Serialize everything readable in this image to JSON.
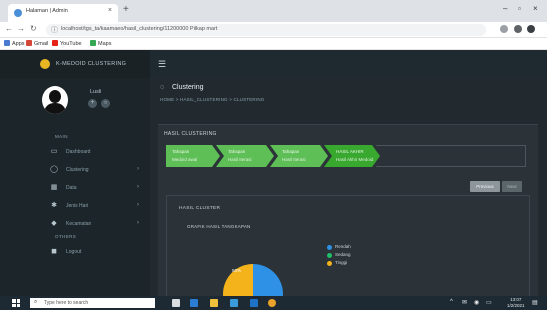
{
  "browser": {
    "tab_title": "Halaman | Admin",
    "tab_close": "×",
    "new_tab": "+",
    "url": "localhost/tgs_ta/kaamaeo/hasil_clustering/11200000 Pilkap mart",
    "window_min": "–",
    "window_max": "▫",
    "window_close": "×",
    "bookmarks": [
      {
        "label": "Apps",
        "color": "#4a7bd0"
      },
      {
        "label": "Gmail",
        "color": "#d44638"
      },
      {
        "label": "YouTube",
        "color": "#e62117"
      },
      {
        "label": "Maps",
        "color": "#34a853"
      }
    ]
  },
  "app": {
    "brand": "K-MEDOID CLUSTERING",
    "user": {
      "name": "Lusli",
      "btn1": "+",
      "btn2": "○"
    },
    "sidebar": {
      "section_main": "MAIN",
      "section_other": "OTHERS",
      "items": [
        {
          "label": "Dashboard",
          "icon": "monitor-icon",
          "glyph": "▭",
          "arrow": ""
        },
        {
          "label": "Clustering",
          "icon": "circle-icon",
          "glyph": "◯",
          "arrow": "›"
        },
        {
          "label": "Data",
          "icon": "table-icon",
          "glyph": "▦",
          "arrow": "›"
        },
        {
          "label": "Jenis Hari",
          "icon": "star-icon",
          "glyph": "✱",
          "arrow": "›"
        },
        {
          "label": "Kecamatan",
          "icon": "map-marker-icon",
          "glyph": "◆",
          "arrow": "›"
        }
      ],
      "logout": {
        "label": "Logout",
        "icon": "logout-icon",
        "glyph": "◼"
      }
    },
    "page": {
      "title": "Clustering",
      "breadcrumb": "HOME  >  HASIL_CLUSTERING  >  CLUSTERING"
    },
    "panel": {
      "title": "HASIL CLUSTERING",
      "steps": [
        {
          "line1": "Tahapan",
          "line2": "Medoid awal"
        },
        {
          "line1": "Tahapan",
          "line2": "Hasil Iterasi"
        },
        {
          "line1": "Tahapan",
          "line2": "Hasil Iterasi"
        },
        {
          "line1": "HASIL AKHIR",
          "line2": "Hasil Akhir Medoid"
        }
      ],
      "btn_previous": "Previous",
      "btn_next": "Next",
      "hasil_title": "HASIL CLUSTER"
    }
  },
  "chart_data": {
    "type": "pie",
    "title": "GRAFIK HASIL TANGKAPAN",
    "categories": [
      "Rendah",
      "Sedang",
      "Tinggi"
    ],
    "colors": [
      "#2e91e5",
      "#1fbf6a",
      "#f4b21b"
    ],
    "values": [
      50,
      0,
      50
    ],
    "slice_labels": [
      "",
      "",
      "50%"
    ],
    "legend_position": "right"
  },
  "taskbar": {
    "search_placeholder": "Type here to search",
    "time": "13:07",
    "date": "1/2/2021",
    "tray_icons": [
      "^",
      "✉",
      "◉",
      "▭"
    ],
    "apps": [
      {
        "name": "task-view-icon",
        "color": "#d9dde0"
      },
      {
        "name": "edge-icon",
        "color": "#2b7cd3"
      },
      {
        "name": "explorer-icon",
        "color": "#f0c23b"
      },
      {
        "name": "store-icon",
        "color": "#3a9bdc"
      },
      {
        "name": "mail-icon",
        "color": "#1e73c8"
      },
      {
        "name": "chrome-icon",
        "color": "#e9a32a"
      }
    ]
  }
}
